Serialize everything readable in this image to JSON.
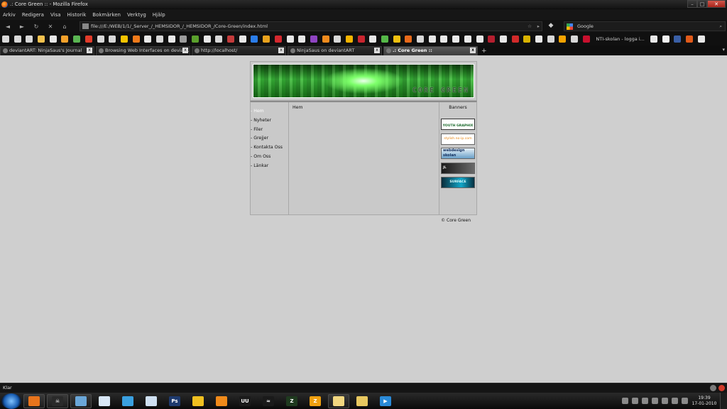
{
  "window": {
    "title": ".: Core Green :: - Mozilla Firefox",
    "minimize": "–",
    "maximize": "□",
    "close": "✕"
  },
  "menu": [
    "Arkiv",
    "Redigera",
    "Visa",
    "Historik",
    "Bokmärken",
    "Verktyg",
    "Hjälp"
  ],
  "nav": {
    "back": "◄",
    "forward": "►",
    "reload": "↻",
    "stop": "✕",
    "home": "⌂",
    "url": "file:///E:/WEB/1/1/_Server_/_HEMSIDOR_/_HEMSIDOR_/Core-Green/index.html",
    "star": "☆",
    "go": "▸",
    "search_placeholder": "Google",
    "search_icon": "⌕"
  },
  "bookmarks": {
    "label": "NTI-skolan - logga i...",
    "icon_colors": [
      "#d8d8d8",
      "#d8d8d8",
      "#d8d8d8",
      "#f2c14e",
      "#e8e8e8",
      "#f3a12b",
      "#5ab552",
      "#e23b2a",
      "#d8d8d8",
      "#d8d8d8",
      "#f5c400",
      "#f07a1a",
      "#e8e8e8",
      "#d8d8d8",
      "#e8e8e8",
      "#9c9c9c",
      "#5aa02c",
      "#e8e8e8",
      "#d8d8d8",
      "#c43b3b",
      "#e8e8e8",
      "#2b7de9",
      "#e9a21d",
      "#d4282f",
      "#e8e8e8",
      "#e8e8e8",
      "#8f44c2",
      "#f08b1d",
      "#d8d8d8",
      "#f5b400",
      "#c9252f",
      "#e8e8e8",
      "#55b848",
      "#f0c010",
      "#e86a1a",
      "#d8d8d8",
      "#e8e8e8",
      "#e8e8e8",
      "#e8e8e8",
      "#e8e8e8",
      "#e8e8e8",
      "#b51f2f",
      "#e8e8e8",
      "#d12a2a",
      "#d8b200",
      "#e8e8e8",
      "#d8d8d8",
      "#f5a300",
      "#d8d8d8",
      "#c8102e",
      "#e8e8e8",
      "#f2f2f2",
      "#3a5fa5",
      "#e05a1a",
      "#e8e8e8"
    ]
  },
  "tabs": [
    {
      "label": "deviantART: NinjaSaus's Journal",
      "active": false
    },
    {
      "label": "Browsing Web Interfaces on devian...",
      "active": false
    },
    {
      "label": "http://localhost/",
      "active": false
    },
    {
      "label": "NinjaSaus on deviantART",
      "active": false
    },
    {
      "label": ".: Core Green ::",
      "active": true
    }
  ],
  "tab_close": "x",
  "tab_new": "+",
  "tab_list": "▾",
  "site": {
    "logo_text": "CORE GREEN",
    "nav": [
      "- Hem",
      "- Nyheter",
      "- Filer",
      "- Grejjer",
      "- Kontakta Oss",
      "- Om Oss",
      "- Länkar"
    ],
    "active_nav": 0,
    "main_heading": "Hem",
    "side_heading": "Banners",
    "banners": [
      "YOUTH GRAPHIX",
      "stylish.no-ip.com",
      "webdesign\nskolan",
      "JL",
      "SURFACE"
    ],
    "footer": "© Core Green"
  },
  "status": {
    "text": "Klar"
  },
  "taskbar": {
    "items": [
      {
        "name": "firefox",
        "color": "#e8741c",
        "glyph": "",
        "open": true
      },
      {
        "name": "alien",
        "color": "#2a2a2a",
        "glyph": "☠",
        "open": true
      },
      {
        "name": "notepad",
        "color": "#6aa6d8",
        "glyph": "",
        "open": true
      },
      {
        "name": "document",
        "color": "#d8e6f5",
        "glyph": "",
        "open": false
      },
      {
        "name": "messenger",
        "color": "#3aa0e0",
        "glyph": "",
        "open": false
      },
      {
        "name": "notes",
        "color": "#cfe0f2",
        "glyph": "",
        "open": false
      },
      {
        "name": "photoshop",
        "color": "#1e3a6e",
        "glyph": "Ps",
        "open": false
      },
      {
        "name": "honeycomb",
        "color": "#f0c020",
        "glyph": "",
        "open": false
      },
      {
        "name": "blender",
        "color": "#f08a1a",
        "glyph": "",
        "open": false
      },
      {
        "name": "uu",
        "color": "#1a1a1a",
        "glyph": "UU",
        "open": false
      },
      {
        "name": "steam",
        "color": "#1a1a1a",
        "glyph": "≈",
        "open": false
      },
      {
        "name": "green-app",
        "color": "#1f3a1f",
        "glyph": "Z",
        "open": false
      },
      {
        "name": "z-app",
        "color": "#f0a010",
        "glyph": "Z",
        "open": false
      },
      {
        "name": "folder",
        "color": "#f2d780",
        "glyph": "",
        "open": true
      },
      {
        "name": "explorer",
        "color": "#e8c860",
        "glyph": "",
        "open": false
      },
      {
        "name": "media-player",
        "color": "#2a8ad8",
        "glyph": "▶",
        "open": false
      }
    ],
    "time": "19:39",
    "date": "17-01-2010"
  }
}
